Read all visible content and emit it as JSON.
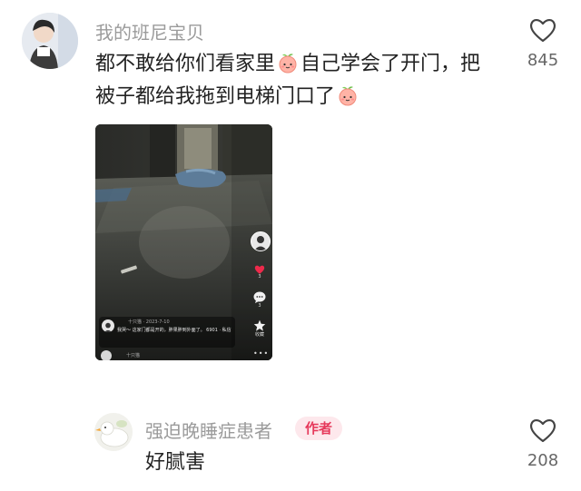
{
  "comment1": {
    "username": "我的班尼宝贝",
    "line1_part1": "都不敢给你们看家里",
    "line1_part2": "自己学会了开门，把",
    "line2_part1": "被子都给我拖到电梯门口了",
    "like_count": "845",
    "video": {
      "likes": "3",
      "comments": "3",
      "favorite_label": "收藏",
      "caption_meta": "十只猫 · 2023-7-10",
      "caption_text": "我哭～ 这家门都是开的，胖果胖到外面了。 6901 · 私信",
      "next_meta": "十只猫"
    }
  },
  "comment2": {
    "username": "强迫晚睡症患者",
    "author_tag": "作者",
    "text": "好腻害",
    "like_count": "208"
  },
  "colors": {
    "like_active": "#ee2a4b",
    "author_tag_bg": "#fde8ec",
    "author_tag_text": "#e6395b"
  }
}
